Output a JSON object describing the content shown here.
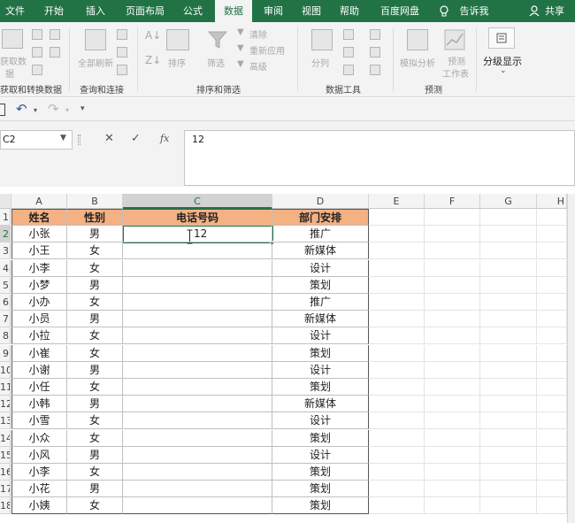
{
  "tabs": [
    "文件",
    "开始",
    "插入",
    "页面布局",
    "公式",
    "数据",
    "审阅",
    "视图",
    "帮助",
    "百度网盘",
    "告诉我",
    "共享"
  ],
  "active_tab": "数据",
  "ribbon": {
    "get_data": {
      "label_line1": "获取数",
      "label_line2": "据"
    },
    "refresh_all": "全部刷新",
    "sort": "排序",
    "filter": "筛选",
    "clear": "清除",
    "reapply": "重新应用",
    "advanced": "高级",
    "text_to_columns": "分列",
    "what_if": "模拟分析",
    "forecast_sheet": {
      "line1": "预测",
      "line2": "工作表"
    },
    "outline": "分级显示",
    "groups": [
      "获取和转换数据",
      "查询和连接",
      "排序和筛选",
      "数据工具",
      "预测"
    ]
  },
  "formula_bar": {
    "name_box": "C2",
    "cancel": "✕",
    "enter": "✓",
    "fx": "fx",
    "content": "12"
  },
  "columns": [
    "A",
    "B",
    "C",
    "D",
    "E",
    "F",
    "G",
    "H"
  ],
  "rows": [
    "1",
    "2",
    "3",
    "4",
    "5",
    "6",
    "7",
    "8",
    "9",
    "10",
    "11",
    "12",
    "13",
    "14",
    "15",
    "16",
    "17",
    "18"
  ],
  "table": {
    "headers": [
      "姓名",
      "性别",
      "电话号码",
      "部门安排"
    ],
    "rows": [
      [
        "小张",
        "男",
        "12",
        "推广"
      ],
      [
        "小王",
        "女",
        "",
        "新媒体"
      ],
      [
        "小李",
        "女",
        "",
        "设计"
      ],
      [
        "小梦",
        "男",
        "",
        "策划"
      ],
      [
        "小办",
        "女",
        "",
        "推广"
      ],
      [
        "小员",
        "男",
        "",
        "新媒体"
      ],
      [
        "小拉",
        "女",
        "",
        "设计"
      ],
      [
        "小崔",
        "女",
        "",
        "策划"
      ],
      [
        "小谢",
        "男",
        "",
        "设计"
      ],
      [
        "小任",
        "女",
        "",
        "策划"
      ],
      [
        "小韩",
        "男",
        "",
        "新媒体"
      ],
      [
        "小雪",
        "女",
        "",
        "设计"
      ],
      [
        "小众",
        "女",
        "",
        "策划"
      ],
      [
        "小风",
        "男",
        "",
        "设计"
      ],
      [
        "小李",
        "女",
        "",
        "策划"
      ],
      [
        "小花",
        "男",
        "",
        "策划"
      ],
      [
        "小姨",
        "女",
        "",
        "策划"
      ]
    ]
  },
  "colors": {
    "brand": "#217346",
    "header_fill": "#f4b183"
  }
}
